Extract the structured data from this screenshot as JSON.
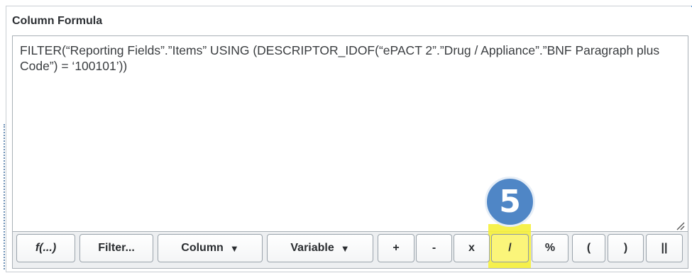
{
  "panel": {
    "title": "Column Formula",
    "formula": "FILTER(“Reporting Fields”.”Items” USING (DESCRIPTOR_IDOF(“ePACT 2”.”Drug / Appliance”.”BNF Paragraph plus Code”) = ‘100101’))"
  },
  "toolbar": {
    "function_label": "f(...)",
    "filter_label": "Filter...",
    "column_label": "Column",
    "variable_label": "Variable",
    "plus_label": "+",
    "minus_label": "-",
    "multiply_label": "x",
    "divide_label": "/",
    "percent_label": "%",
    "open_paren_label": "(",
    "close_paren_label": ")",
    "concat_label": "||",
    "dropdown_caret": "▼"
  },
  "annotation": {
    "step_number": "5",
    "highlight_color": "#f5f03a",
    "badge_color": "#4f86c6"
  }
}
